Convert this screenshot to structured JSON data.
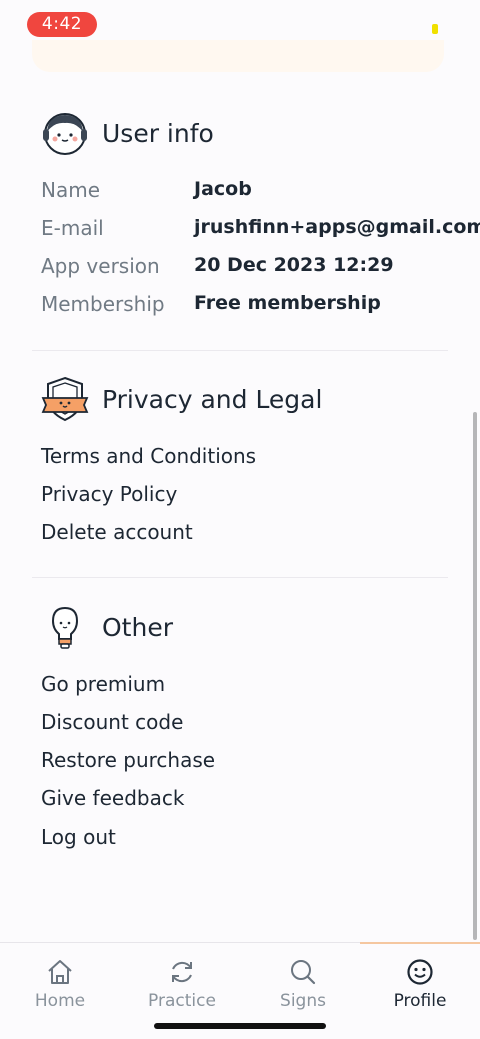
{
  "status_bar": {
    "time": "4:42"
  },
  "user_info": {
    "title": "User info",
    "rows": [
      {
        "label": "Name",
        "value": "Jacob"
      },
      {
        "label": "E-mail",
        "value": "jrushfinn+apps@gmail.com"
      },
      {
        "label": "App version",
        "value": "20 Dec 2023 12:29"
      },
      {
        "label": "Membership",
        "value": "Free membership"
      }
    ]
  },
  "privacy": {
    "title": "Privacy and Legal",
    "items": [
      "Terms and Conditions",
      "Privacy Policy",
      "Delete account"
    ]
  },
  "other": {
    "title": "Other",
    "items": [
      "Go premium",
      "Discount code",
      "Restore purchase",
      "Give feedback",
      "Log out"
    ]
  },
  "tab_bar": {
    "tabs": [
      {
        "label": "Home",
        "icon": "home-icon"
      },
      {
        "label": "Practice",
        "icon": "refresh-icon"
      },
      {
        "label": "Signs",
        "icon": "search-icon"
      },
      {
        "label": "Profile",
        "icon": "smiley-icon",
        "active": true
      }
    ]
  },
  "colors": {
    "accent": "#f5a066",
    "time_pill": "#f0463f",
    "text": "#1d2733",
    "muted": "#707a84"
  }
}
